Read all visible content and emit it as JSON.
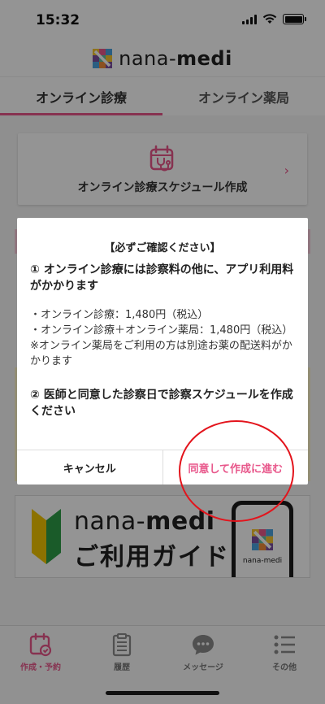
{
  "status_bar": {
    "time": "15:32"
  },
  "header": {
    "brand_light": "nana-",
    "brand_bold": "medi"
  },
  "tabs": [
    {
      "label": "オンライン診療",
      "active": true
    },
    {
      "label": "オンライン薬局",
      "active": false
    }
  ],
  "schedule_card": {
    "label": "オンライン診療スケジュール作成",
    "chevron": "›"
  },
  "guide_banner": {
    "brand_light": "nana-",
    "brand_bold": "medi",
    "title": "ご利用ガイド",
    "phone_brand": "nana-medi"
  },
  "dialog": {
    "title": "【必ずご確認ください】",
    "notice1_head": "① オンライン診療には診察料の他に、アプリ利用料がかかります",
    "notice1_lines": [
      "・オンライン診療：1,480円（税込）",
      "・オンライン診療＋オンライン薬局：1,480円（税込）",
      "※オンライン薬局をご利用の方は別途お薬の配送料がかかります"
    ],
    "notice2_head": "② 医師と同意した診察日で診察スケジュールを作成ください",
    "cancel_label": "キャンセル",
    "agree_label": "同意して作成に進む"
  },
  "tab_bar": [
    {
      "label": "作成・予約",
      "icon": "calendar-check-icon",
      "active": true
    },
    {
      "label": "履歴",
      "icon": "clipboard-icon",
      "active": false
    },
    {
      "label": "メッセージ",
      "icon": "chat-bubble-icon",
      "active": false
    },
    {
      "label": "その他",
      "icon": "menu-list-icon",
      "active": false
    }
  ],
  "colors": {
    "accent": "#e8578b",
    "annotation": "#e3141c"
  }
}
